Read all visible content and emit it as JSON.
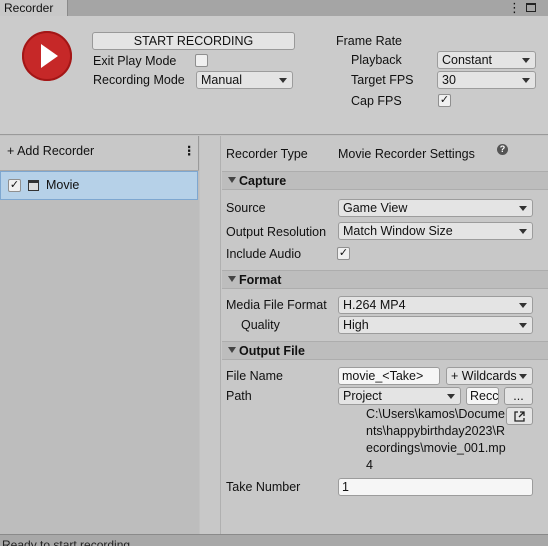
{
  "window": {
    "tab_title": "Recorder",
    "menu_glyph": "⋮"
  },
  "header": {
    "start_recording_label": "START RECORDING",
    "exit_play_mode_label": "Exit Play Mode",
    "exit_play_mode_checked": false,
    "recording_mode_label": "Recording Mode",
    "recording_mode_value": "Manual",
    "frame_rate_label": "Frame Rate",
    "playback_label": "Playback",
    "playback_value": "Constant",
    "target_fps_label": "Target FPS",
    "target_fps_value": "30",
    "cap_fps_label": "Cap FPS",
    "cap_fps_checked": true
  },
  "sidebar": {
    "add_recorder_label": "+ Add Recorder",
    "menu_glyph": "⋮",
    "recorders": [
      {
        "name": "Movie",
        "enabled": true,
        "icon": "movie-clapper-icon"
      }
    ]
  },
  "settings": {
    "recorder_type_label": "Recorder Type",
    "recorder_type_value": "Movie Recorder Settings",
    "help_glyph": "?",
    "capture": {
      "title": "Capture",
      "source_label": "Source",
      "source_value": "Game View",
      "output_resolution_label": "Output Resolution",
      "output_resolution_value": "Match Window Size",
      "include_audio_label": "Include Audio",
      "include_audio_checked": true
    },
    "format": {
      "title": "Format",
      "media_file_format_label": "Media File Format",
      "media_file_format_value": "H.264 MP4",
      "quality_label": "Quality",
      "quality_value": "High"
    },
    "output_file": {
      "title": "Output File",
      "file_name_label": "File Name",
      "file_name_value": "movie_<Take>",
      "wildcards_label": "+ Wildcards",
      "path_label": "Path",
      "path_root_value": "Project",
      "path_field_value": "Recc",
      "browse_label": "...",
      "resolved_path": "C:\\Users\\kamos\\Documents\\happybirthday2023\\Recordings\\movie_001.mp4",
      "take_number_label": "Take Number",
      "take_number_value": "1"
    }
  },
  "status": {
    "text": "Ready to start recording"
  },
  "colors": {
    "record_button": "#c62828",
    "selection": "#b6d1e8"
  }
}
